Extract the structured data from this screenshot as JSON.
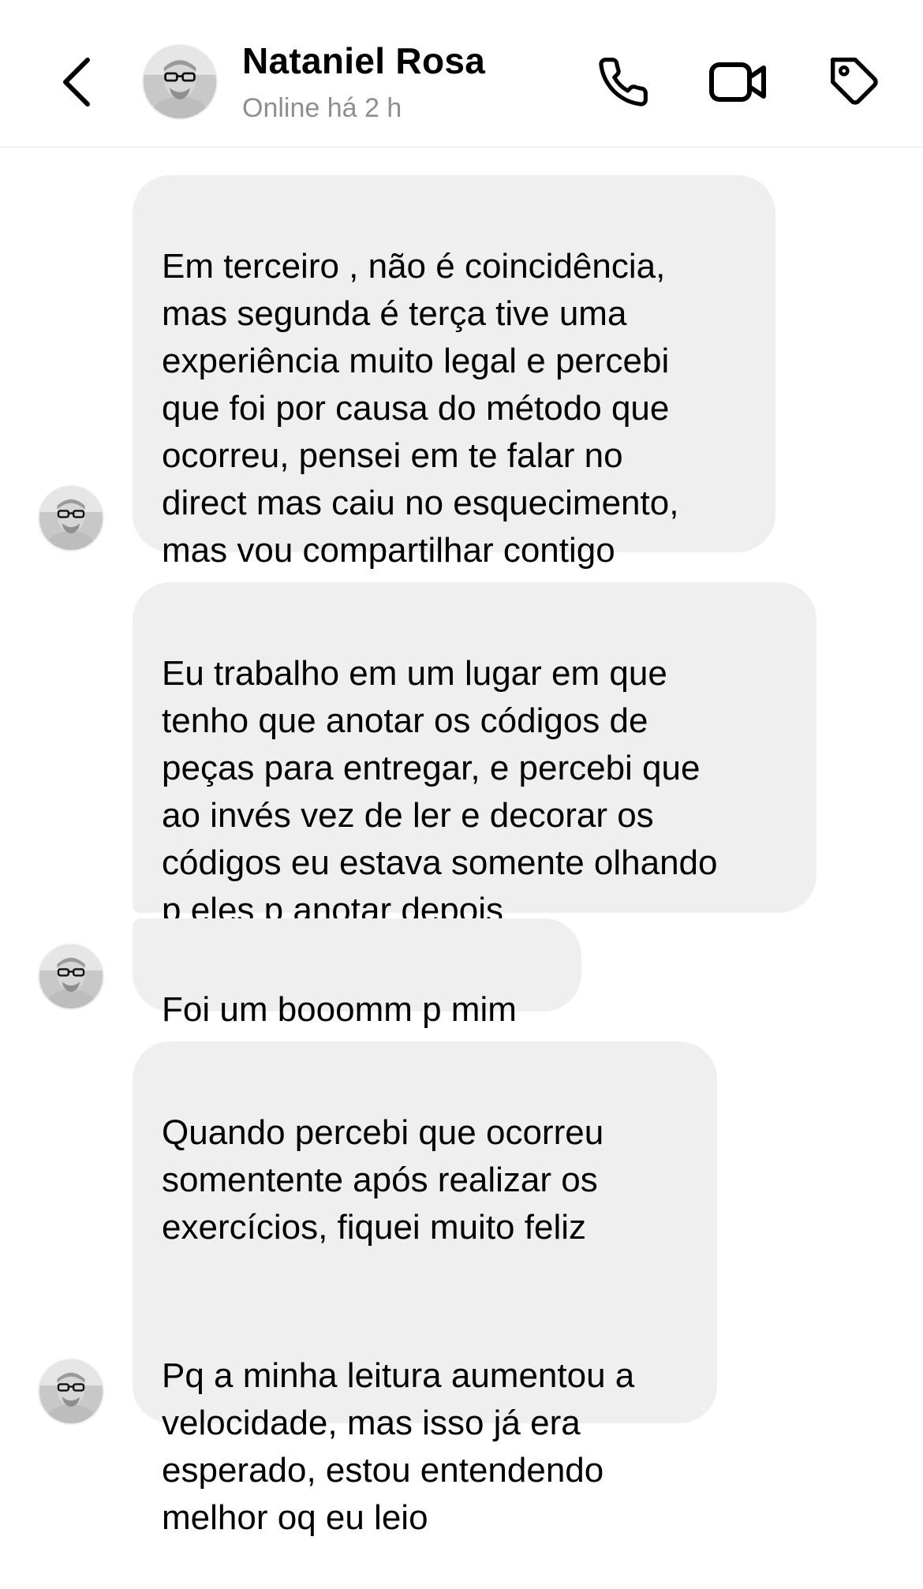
{
  "header": {
    "contact_name": "Nataniel Rosa",
    "status": "Online há 2 h",
    "icons": {
      "back": "chevron-left-icon",
      "call": "phone-icon",
      "video": "video-camera-icon",
      "tag": "tag-icon"
    }
  },
  "messages": [
    {
      "text": "Em terceiro , não é coincidência,\nmas segunda é terça tive uma\nexperiência muito legal e percebi\nque foi por causa do método que\nocorreu, pensei em te falar no\ndirect mas caiu no esquecimento,\nmas vou compartilhar contigo"
    },
    {
      "text": "Eu trabalho em um lugar em que\ntenho que anotar os códigos de\npeças para entregar, e percebi que\nao invés vez de ler e decorar os\ncódigos eu estava somente olhando\np eles p anotar depois"
    },
    {
      "text": "Foi um booomm p mim"
    },
    {
      "lines_a": "Quando percebi que ocorreu\nsomentente após realizar os\nexercícios, fiquei muito feliz",
      "lines_b": "Pq a minha leitura aumentou a\nvelocidade, mas isso já era\nesperado, estou entendendo\nmelhor oq eu leio"
    }
  ],
  "colors": {
    "bubble_background": "#efefef",
    "status_text": "#8e8e8e",
    "divider": "#e3e3e3"
  }
}
